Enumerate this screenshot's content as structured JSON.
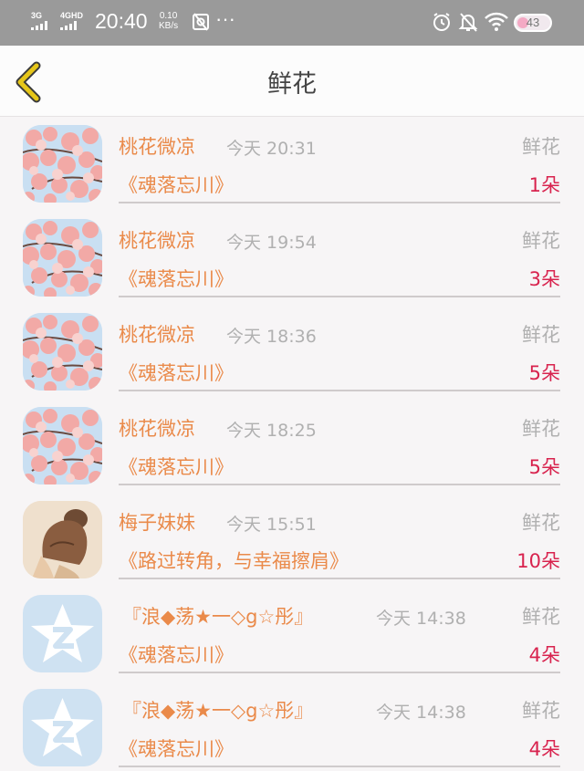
{
  "status_bar": {
    "net_3g": "3G",
    "net_4g": "4GHD",
    "time": "20:40",
    "speed_value": "0.10",
    "speed_unit": "KB/s",
    "more": "···",
    "battery": "43"
  },
  "header": {
    "title": "鲜花"
  },
  "gifts": [
    {
      "sender": "桃花微凉",
      "time": "今天 20:31",
      "type": "鲜花",
      "book": "《魂落忘川》",
      "count": "1朵",
      "avatar": "blossom"
    },
    {
      "sender": "桃花微凉",
      "time": "今天 19:54",
      "type": "鲜花",
      "book": "《魂落忘川》",
      "count": "3朵",
      "avatar": "blossom"
    },
    {
      "sender": "桃花微凉",
      "time": "今天 18:36",
      "type": "鲜花",
      "book": "《魂落忘川》",
      "count": "5朵",
      "avatar": "blossom"
    },
    {
      "sender": "桃花微凉",
      "time": "今天 18:25",
      "type": "鲜花",
      "book": "《魂落忘川》",
      "count": "5朵",
      "avatar": "blossom"
    },
    {
      "sender": "梅子妹妹",
      "time": "今天 15:51",
      "type": "鲜花",
      "book": "《路过转角，与幸福擦肩》",
      "count": "10朵",
      "avatar": "girl"
    },
    {
      "sender": "『浪◆荡★一◇g☆彤』",
      "time": "今天 14:38",
      "type": "鲜花",
      "book": "《魂落忘川》",
      "count": "4朵",
      "avatar": "qq-default"
    },
    {
      "sender": "『浪◆荡★一◇g☆彤』",
      "time": "今天 14:38",
      "type": "鲜花",
      "book": "《魂落忘川》",
      "count": "4朵",
      "avatar": "qq-default"
    }
  ],
  "colors": {
    "accent": "#ea8a4a",
    "count": "#d8234e",
    "muted": "#b0b0b0",
    "back_arrow": "#e6c619"
  }
}
